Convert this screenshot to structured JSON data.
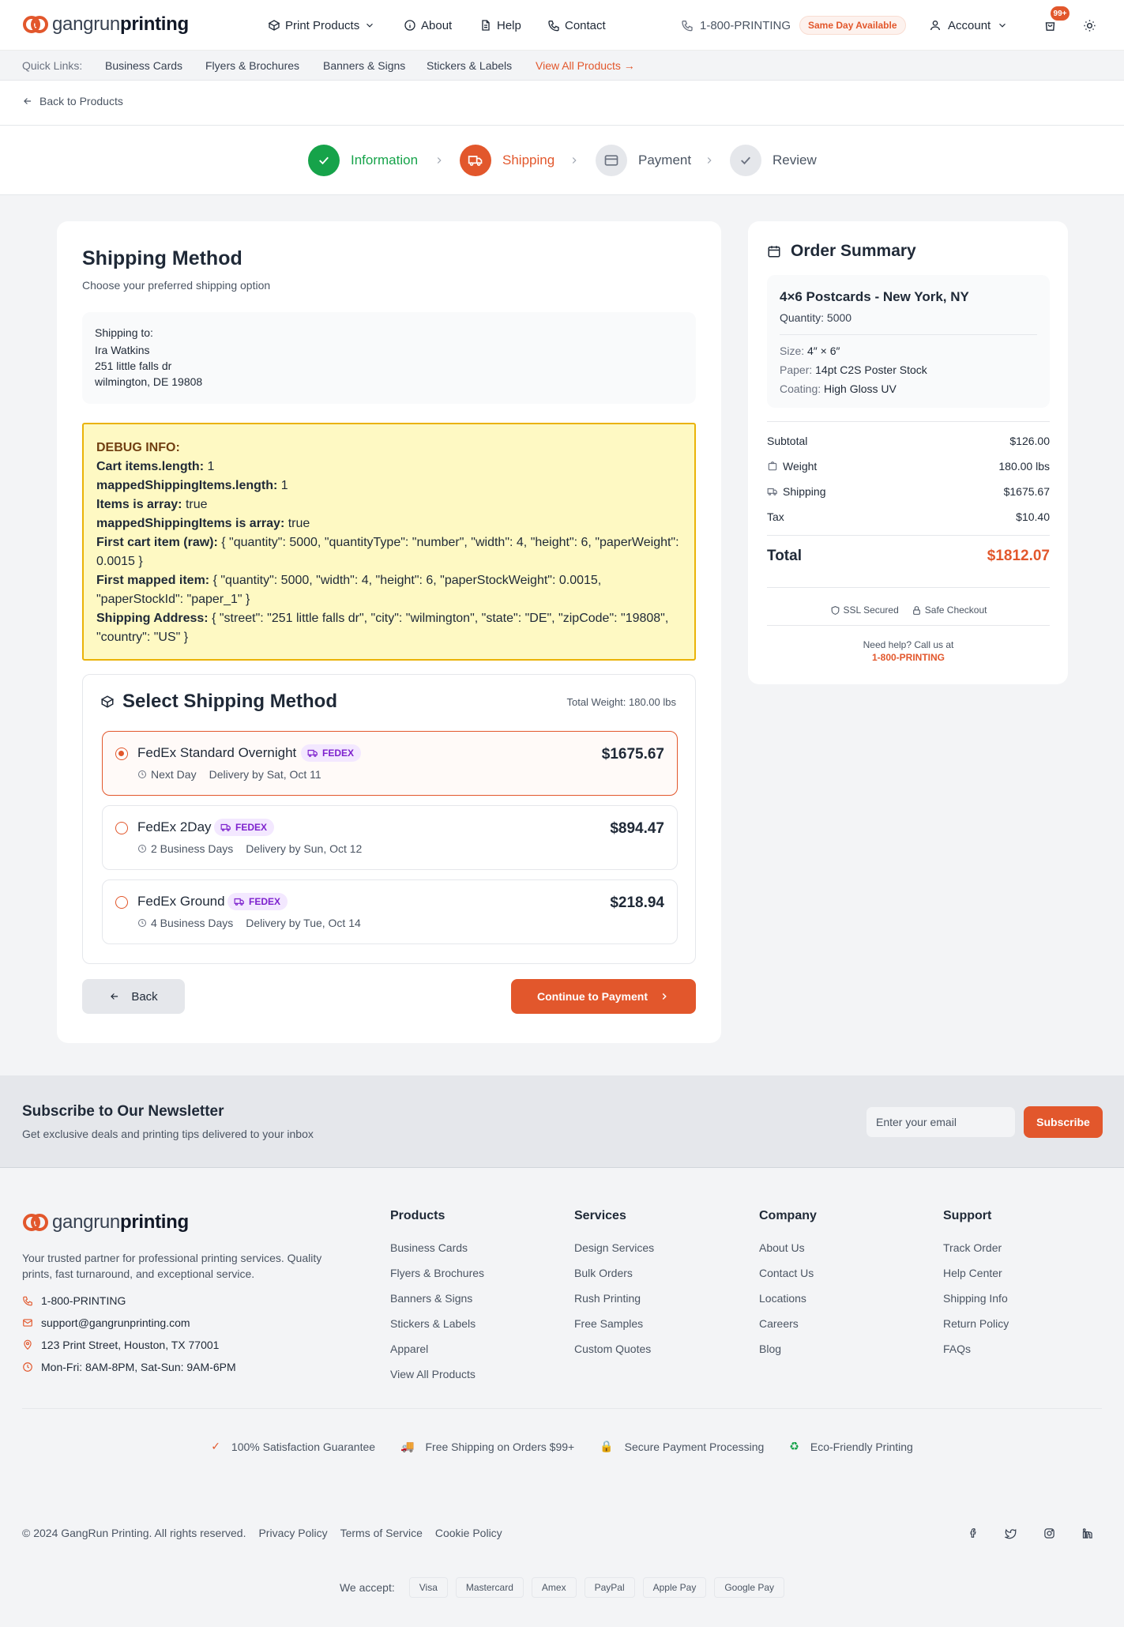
{
  "brand": {
    "logo_light": "gangrun",
    "logo_bold": "printing",
    "accent": "#e2572c"
  },
  "nav": {
    "print_products": "Print Products",
    "about": "About",
    "help": "Help",
    "contact": "Contact",
    "phone": "1-800-PRINTING",
    "same_day": "Same Day Available",
    "account": "Account",
    "cart_badge": "99+"
  },
  "quick_links": {
    "label": "Quick Links:",
    "items": [
      "Business Cards",
      "Flyers & Brochures",
      "Banners & Signs",
      "Stickers & Labels"
    ],
    "view_all": "View All Products →"
  },
  "back_link": "Back to Products",
  "stepper": {
    "steps": [
      {
        "label": "Information",
        "state": "complete",
        "icon": "check-icon"
      },
      {
        "label": "Shipping",
        "state": "current",
        "icon": "truck-icon"
      },
      {
        "label": "Payment",
        "state": "upcoming",
        "icon": "credit-card-icon"
      },
      {
        "label": "Review",
        "state": "upcoming",
        "icon": "check-icon"
      }
    ]
  },
  "shipping": {
    "title": "Shipping Method",
    "subtitle": "Choose your preferred shipping option",
    "ship_to_label": "Shipping to:",
    "name": "Ira Watkins",
    "street": "251 little falls dr",
    "city_line": "wilmington, DE 19808"
  },
  "debug": {
    "title": "DEBUG INFO:",
    "lines": [
      {
        "k": "Cart items.length:",
        "v": " 1"
      },
      {
        "k": "mappedShippingItems.length:",
        "v": " 1"
      },
      {
        "k": "Items is array:",
        "v": " true"
      },
      {
        "k": "mappedShippingItems is array:",
        "v": " true"
      },
      {
        "k": "First cart item (raw):",
        "v": " { \"quantity\": 5000, \"quantityType\": \"number\", \"width\": 4, \"height\": 6, \"paperWeight\": 0.0015 }"
      },
      {
        "k": "First mapped item:",
        "v": " { \"quantity\": 5000, \"width\": 4, \"height\": 6, \"paperStockWeight\": 0.0015, \"paperStockId\": \"paper_1\" }"
      },
      {
        "k": "Shipping Address:",
        "v": " { \"street\": \"251 little falls dr\", \"city\": \"wilmington\", \"state\": \"DE\", \"zipCode\": \"19808\", \"country\": \"US\" }"
      }
    ]
  },
  "select_method": {
    "title": "Select Shipping Method",
    "total_weight": "Total Weight: 180.00 lbs",
    "options": [
      {
        "name": "FedEx Standard Overnight",
        "carrier": "FEDEX",
        "speed": "Next Day",
        "delivery": "Delivery by Sat, Oct 11",
        "price": "$1675.67",
        "selected": true
      },
      {
        "name": "FedEx 2Day",
        "carrier": "FEDEX",
        "speed": "2 Business Days",
        "delivery": "Delivery by Sun, Oct 12",
        "price": "$894.47",
        "selected": false
      },
      {
        "name": "FedEx Ground",
        "carrier": "FEDEX",
        "speed": "4 Business Days",
        "delivery": "Delivery by Tue, Oct 14",
        "price": "$218.94",
        "selected": false
      }
    ]
  },
  "buttons": {
    "back": "Back",
    "continue": "Continue to Payment"
  },
  "summary": {
    "title": "Order Summary",
    "product": "4×6 Postcards - New York, NY",
    "quantity": "Quantity: 5000",
    "size_k": "Size:",
    "size_v": "4″ × 6″",
    "paper_k": "Paper:",
    "paper_v": "14pt C2S Poster Stock",
    "coating_k": "Coating:",
    "coating_v": "High Gloss UV",
    "subtotal_k": "Subtotal",
    "subtotal_v": "$126.00",
    "weight_k": "Weight",
    "weight_v": "180.00 lbs",
    "shipping_k": "Shipping",
    "shipping_v": "$1675.67",
    "tax_k": "Tax",
    "tax_v": "$10.40",
    "total_k": "Total",
    "total_v": "$1812.07",
    "ssl": "SSL Secured",
    "safe": "Safe Checkout",
    "help": "Need help? Call us at",
    "help_phone": "1-800-PRINTING"
  },
  "newsletter": {
    "title": "Subscribe to Our Newsletter",
    "subtitle": "Get exclusive deals and printing tips delivered to your inbox",
    "placeholder": "Enter your email",
    "button": "Subscribe"
  },
  "footer": {
    "description": "Your trusted partner for professional printing services. Quality prints, fast turnaround, and exceptional service.",
    "phone": "1-800-PRINTING",
    "email": "support@gangrunprinting.com",
    "address": "123 Print Street, Houston, TX 77001",
    "hours": "Mon-Fri: 8AM-8PM, Sat-Sun: 9AM-6PM",
    "columns": [
      {
        "title": "Products",
        "links": [
          "Business Cards",
          "Flyers & Brochures",
          "Banners & Signs",
          "Stickers & Labels",
          "Apparel",
          "View All Products"
        ]
      },
      {
        "title": "Services",
        "links": [
          "Design Services",
          "Bulk Orders",
          "Rush Printing",
          "Free Samples",
          "Custom Quotes"
        ]
      },
      {
        "title": "Company",
        "links": [
          "About Us",
          "Contact Us",
          "Locations",
          "Careers",
          "Blog"
        ]
      },
      {
        "title": "Support",
        "links": [
          "Track Order",
          "Help Center",
          "Shipping Info",
          "Return Policy",
          "FAQs"
        ]
      }
    ],
    "badges": [
      {
        "icon": "✓",
        "text": "100% Satisfaction Guarantee",
        "color": "#e2572c"
      },
      {
        "icon": "🚚",
        "text": "Free Shipping on Orders $99+",
        "color": "#e2572c"
      },
      {
        "icon": "🔒",
        "text": "Secure Payment Processing",
        "color": "#ca8a04"
      },
      {
        "icon": "♻",
        "text": "Eco-Friendly Printing",
        "color": "#16a34a"
      }
    ],
    "copyright": "© 2024 GangRun Printing. All rights reserved.",
    "legal": [
      "Privacy Policy",
      "Terms of Service",
      "Cookie Policy"
    ],
    "we_accept": "We accept:",
    "payments": [
      "Visa",
      "Mastercard",
      "Amex",
      "PayPal",
      "Apple Pay",
      "Google Pay"
    ]
  }
}
